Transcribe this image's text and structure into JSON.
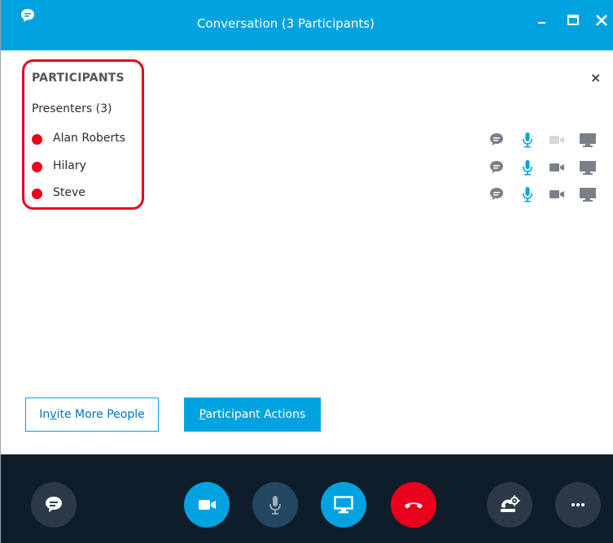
{
  "window": {
    "title": "Conversation (3 Participants)",
    "controls": {
      "minimize": "–",
      "maximize": "☐",
      "close": "✕"
    }
  },
  "panel": {
    "heading": "PARTICIPANTS",
    "close_glyph": "×",
    "group_label": "Presenters (3)",
    "participants": [
      {
        "name": "Alan Roberts",
        "status_color": "#e8001c",
        "video_enabled": false
      },
      {
        "name": "Hilary",
        "status_color": "#e8001c",
        "video_enabled": true
      },
      {
        "name": "Steve",
        "status_color": "#e8001c",
        "video_enabled": true
      }
    ]
  },
  "actions": {
    "invite_pre": "In",
    "invite_u": "v",
    "invite_post": "ite More People",
    "participant_u": "P",
    "participant_post": "articipant Actions"
  },
  "bottom_controls": [
    {
      "name": "chat-button",
      "icon": "chat-icon",
      "color": "#2c3a48"
    },
    {
      "name": "video-button",
      "icon": "video-camera-icon",
      "color": "#00a3e0"
    },
    {
      "name": "mute-button",
      "icon": "microphone-icon",
      "color": "#244762"
    },
    {
      "name": "present-button",
      "icon": "monitor-icon",
      "color": "#00a3e0"
    },
    {
      "name": "hang-up-button",
      "icon": "phone-hangup-icon",
      "color": "#e8001c"
    },
    {
      "name": "call-controls-button",
      "icon": "phone-gear-icon",
      "color": "#2c3a48"
    },
    {
      "name": "more-options-button",
      "icon": "ellipsis-icon",
      "color": "#2c3a48"
    }
  ],
  "colors": {
    "accent": "#00a3e0",
    "status_busy": "#e8001c",
    "bottom_bar": "#0e1d2a",
    "icon_gray": "#7a8088"
  }
}
